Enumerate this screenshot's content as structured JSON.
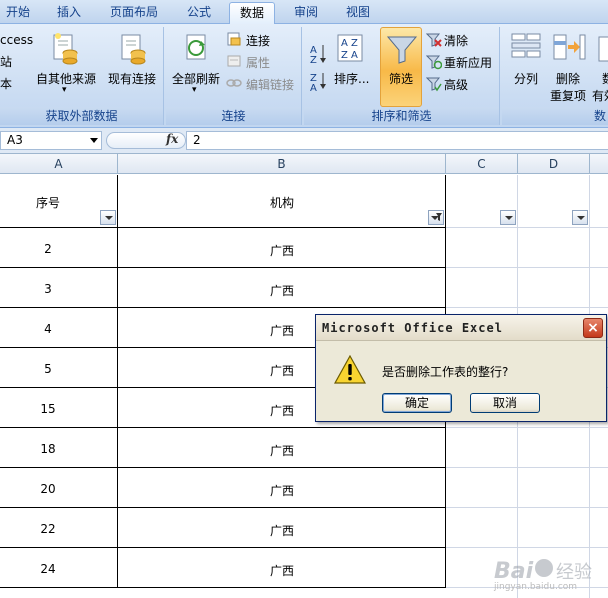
{
  "tabs": [
    "开始",
    "插入",
    "页面布局",
    "公式",
    "数据",
    "审阅",
    "视图"
  ],
  "active_tab": "数据",
  "ribbon": {
    "external": {
      "access": "ccess",
      "web": "站",
      "text": "本",
      "other_sources": "自其他来源",
      "existing": "现有连接",
      "label": "获取外部数据"
    },
    "connections": {
      "refresh_all": "全部刷新",
      "connections": "连接",
      "properties": "属性",
      "edit_links": "编辑链接",
      "label": "连接"
    },
    "sort_filter": {
      "sort": "排序...",
      "filter": "筛选",
      "clear": "清除",
      "reapply": "重新应用",
      "advanced": "高级",
      "label": "排序和筛选"
    },
    "data_tools": {
      "split": "分列",
      "remove_dup_1": "删除",
      "remove_dup_2": "重复项",
      "valid_1": "数",
      "valid_2": "有效",
      "label": "数"
    }
  },
  "formula_bar": {
    "name_box": "A3",
    "fx": "fx",
    "value": "2"
  },
  "columns": [
    "A",
    "B",
    "C",
    "D"
  ],
  "header_row": {
    "a": "序号",
    "b": "机构"
  },
  "rows": [
    {
      "a": "2",
      "b": "广西"
    },
    {
      "a": "3",
      "b": "广西"
    },
    {
      "a": "4",
      "b": "广西"
    },
    {
      "a": "5",
      "b": "广西"
    },
    {
      "a": "15",
      "b": "广西"
    },
    {
      "a": "18",
      "b": "广西"
    },
    {
      "a": "20",
      "b": "广西"
    },
    {
      "a": "22",
      "b": "广西"
    },
    {
      "a": "24",
      "b": "广西"
    }
  ],
  "dialog": {
    "title": "Microsoft Office Excel",
    "message": "是否删除工作表的整行?",
    "ok": "确定",
    "cancel": "取消",
    "close": "×"
  },
  "watermark": {
    "text": "jingyan.baidu.com"
  },
  "colors": {
    "ribbon_text": "#15428b",
    "filter_active": "#f9a93a",
    "dialog_border": "#0a246a",
    "close_red": "#c4391b"
  }
}
